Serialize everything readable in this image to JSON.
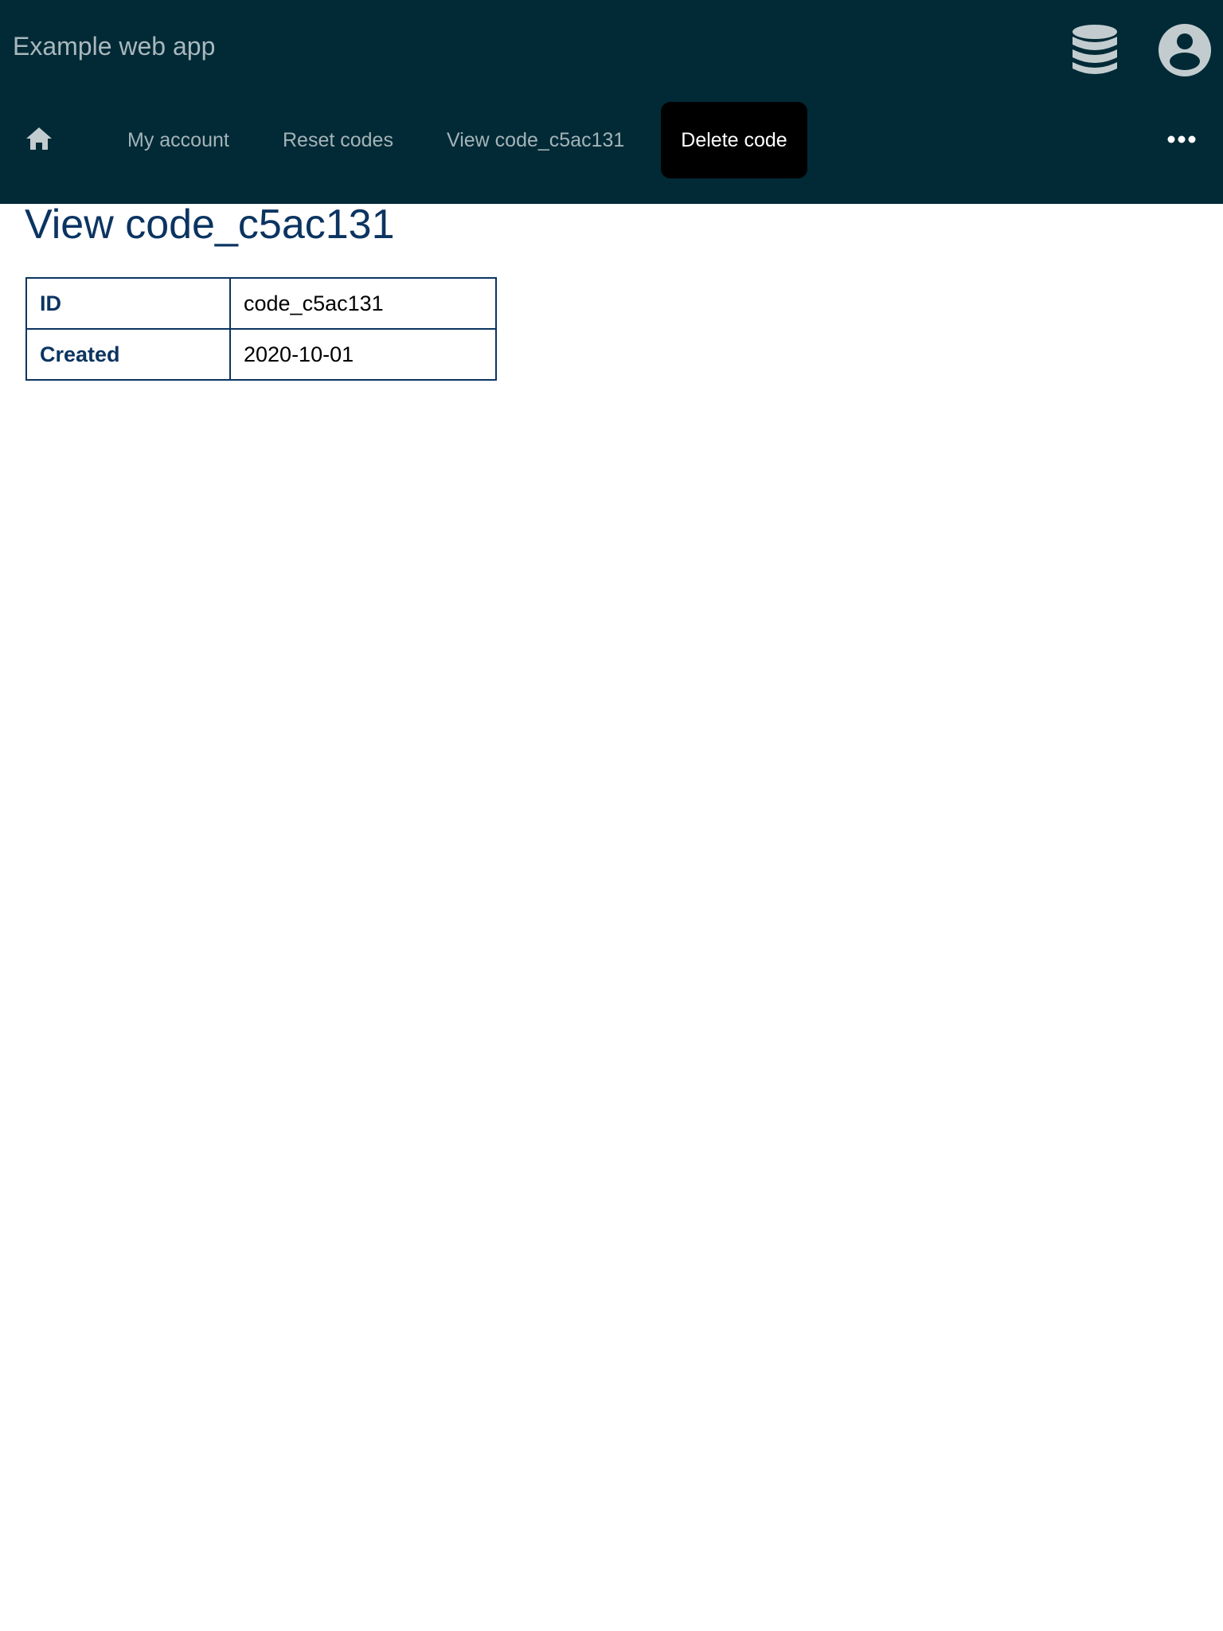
{
  "header": {
    "app_title": "Example web app",
    "icons": [
      "database-icon",
      "account-circle-icon"
    ]
  },
  "nav": {
    "home_icon": "home-icon",
    "items": [
      "My account",
      "Reset codes",
      "View code_c5ac131"
    ],
    "active_button": "Delete code",
    "more_icon": "more-horizontal-icon"
  },
  "page": {
    "title": "View code_c5ac131",
    "rows": [
      {
        "label": "ID",
        "value": "code_c5ac131"
      },
      {
        "label": "Created",
        "value": "2020-10-01"
      }
    ]
  },
  "colors": {
    "header_bg": "#012a36",
    "accent": "#0b3461",
    "active_bg": "#000000"
  }
}
